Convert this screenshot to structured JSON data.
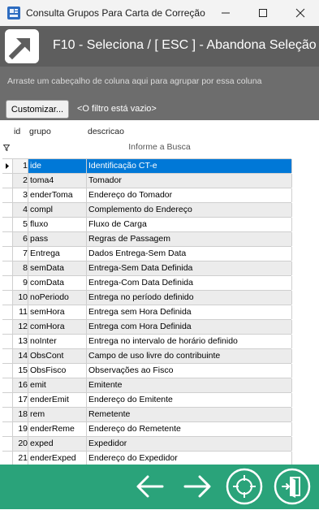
{
  "window": {
    "title": "Consulta Grupos Para Carta de Correção",
    "minimize_icon": "minimize-icon",
    "maximize_icon": "maximize-icon",
    "close_icon": "close-icon"
  },
  "header": {
    "text": "F10 - Seleciona /  [ ESC ] - Abandona Seleção"
  },
  "grid": {
    "group_hint": "Arraste um cabeçalho de coluna aqui para agrupar por essa coluna",
    "customize_label": "Customizar...",
    "filter_status": "<O filtro está vazio>",
    "columns": [
      "id",
      "grupo",
      "descricao"
    ],
    "filter_prompt": "Informe a Busca",
    "selected_row": 0,
    "rows": [
      {
        "id": "1",
        "grupo": "ide",
        "descricao": "Identificação CT-e"
      },
      {
        "id": "2",
        "grupo": "toma4",
        "descricao": "Tomador"
      },
      {
        "id": "3",
        "grupo": "enderToma",
        "descricao": "Endereço do Tomador"
      },
      {
        "id": "4",
        "grupo": "compl",
        "descricao": "Complemento do Endereço"
      },
      {
        "id": "5",
        "grupo": "fluxo",
        "descricao": "Fluxo de Carga"
      },
      {
        "id": "6",
        "grupo": "pass",
        "descricao": "Regras de Passagem"
      },
      {
        "id": "7",
        "grupo": "Entrega",
        "descricao": "Dados Entrega-Sem Data"
      },
      {
        "id": "8",
        "grupo": "semData",
        "descricao": "Entrega-Sem Data Definida"
      },
      {
        "id": "9",
        "grupo": "comData",
        "descricao": "Entrega-Com Data Definida"
      },
      {
        "id": "10",
        "grupo": "noPeriodo",
        "descricao": "Entrega no período definido"
      },
      {
        "id": "11",
        "grupo": "semHora",
        "descricao": "Entrega sem Hora Definida"
      },
      {
        "id": "12",
        "grupo": "comHora",
        "descricao": "Entrega com Hora Definida"
      },
      {
        "id": "13",
        "grupo": "noInter",
        "descricao": "Entrega no intervalo de horário definido"
      },
      {
        "id": "14",
        "grupo": "ObsCont",
        "descricao": "Campo de uso livre do contribuinte"
      },
      {
        "id": "15",
        "grupo": "ObsFisco",
        "descricao": "Observações ao Fisco"
      },
      {
        "id": "16",
        "grupo": "emit",
        "descricao": "Emitente"
      },
      {
        "id": "17",
        "grupo": "enderEmit",
        "descricao": "Endereço do Emitente"
      },
      {
        "id": "18",
        "grupo": "rem",
        "descricao": "Remetente"
      },
      {
        "id": "19",
        "grupo": "enderReme",
        "descricao": "Endereço do Remetente"
      },
      {
        "id": "20",
        "grupo": "exped",
        "descricao": "Expedidor"
      },
      {
        "id": "21",
        "grupo": "enderExped",
        "descricao": "Endereço do Expedidor"
      }
    ]
  },
  "nav": {
    "prev_icon": "arrow-left-icon",
    "next_icon": "arrow-right-icon",
    "select_icon": "crosshair-icon",
    "exit_icon": "exit-door-icon"
  },
  "colors": {
    "header_bg": "#5e5e5e",
    "group_bg": "#6d6d6d",
    "selection": "#0078d7",
    "bottom_bar": "#2aa37a"
  }
}
